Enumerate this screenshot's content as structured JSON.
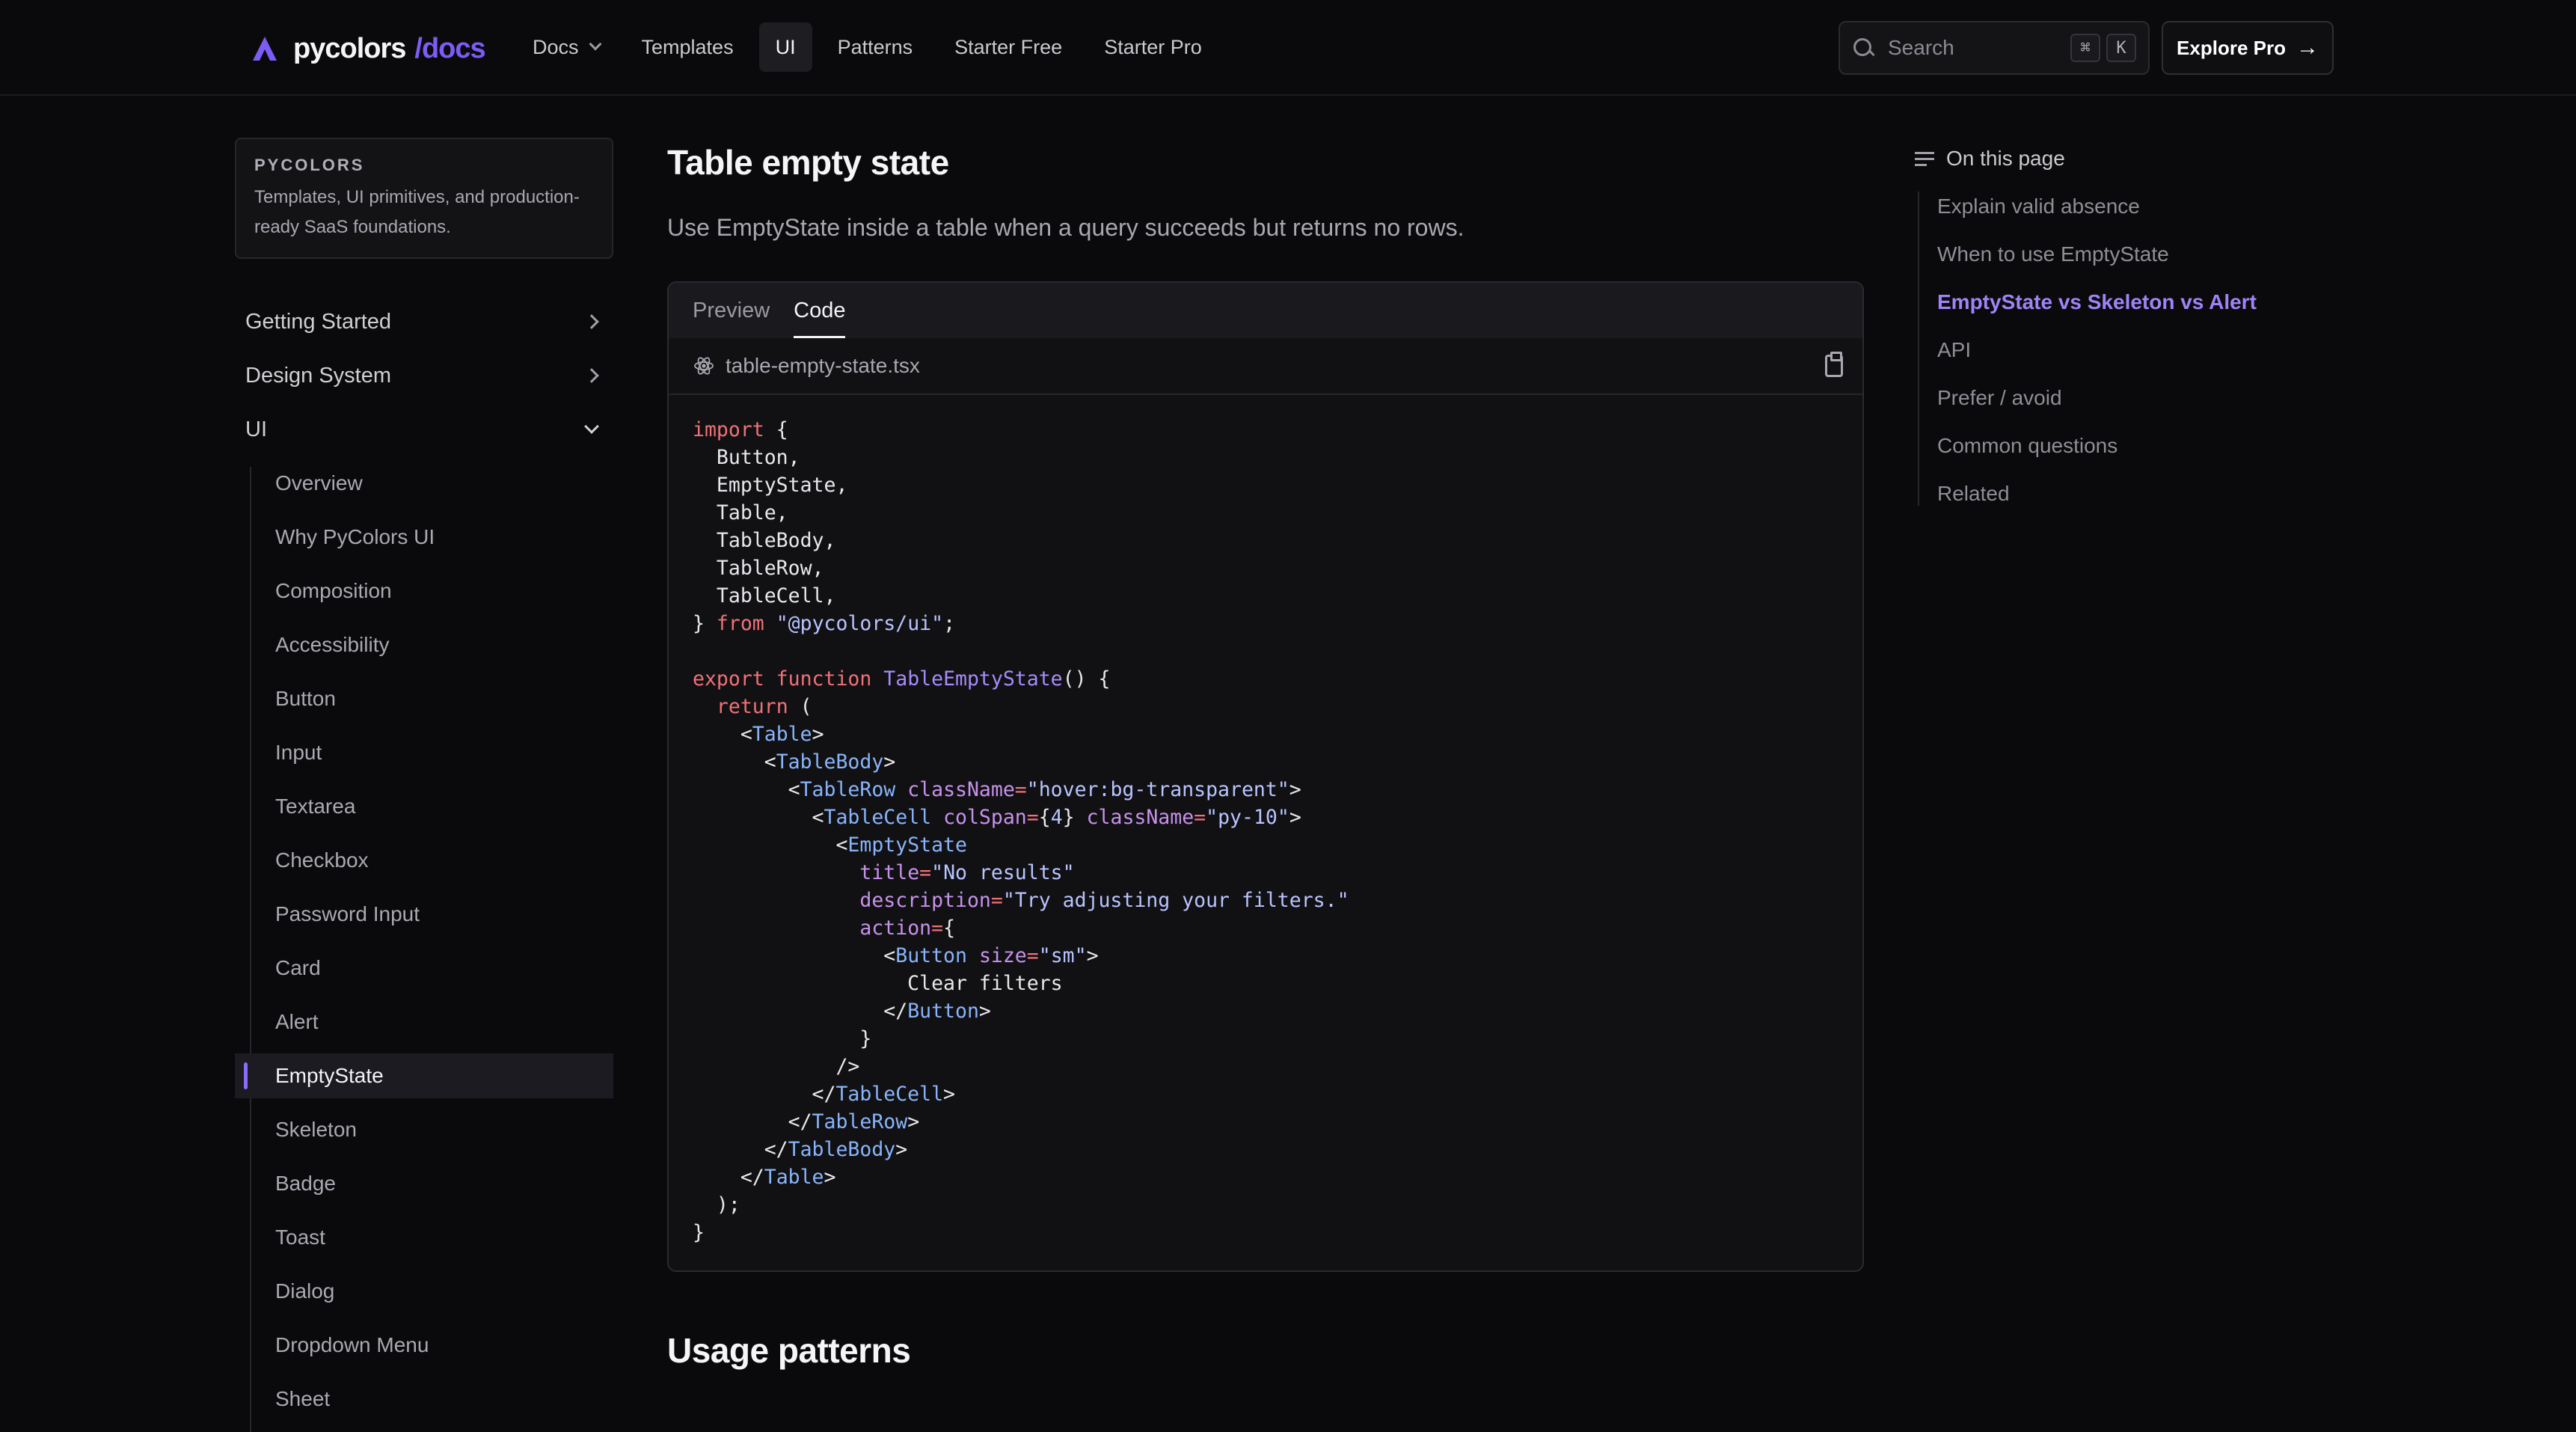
{
  "header": {
    "logo_text": "pycolors",
    "logo_suffix": "/docs",
    "nav": [
      {
        "label": "Docs",
        "has_dropdown": true,
        "active": false
      },
      {
        "label": "Templates",
        "active": false
      },
      {
        "label": "UI",
        "active": true
      },
      {
        "label": "Patterns",
        "active": false
      },
      {
        "label": "Starter Free",
        "active": false
      },
      {
        "label": "Starter Pro",
        "active": false
      }
    ],
    "search_placeholder": "Search",
    "shortcut_keys": [
      "⌘",
      "K"
    ],
    "explore_label": "Explore Pro"
  },
  "sidebar": {
    "brand_title": "PYCOLORS",
    "brand_desc": "Templates, UI primitives, and production-ready SaaS foundations.",
    "sections": [
      {
        "label": "Getting Started",
        "expanded": false
      },
      {
        "label": "Design System",
        "expanded": false
      },
      {
        "label": "UI",
        "expanded": true
      }
    ],
    "ui_items": [
      {
        "label": "Overview"
      },
      {
        "label": "Why PyColors UI"
      },
      {
        "label": "Composition"
      },
      {
        "label": "Accessibility"
      },
      {
        "label": "Button"
      },
      {
        "label": "Input"
      },
      {
        "label": "Textarea"
      },
      {
        "label": "Checkbox"
      },
      {
        "label": "Password Input"
      },
      {
        "label": "Card"
      },
      {
        "label": "Alert"
      },
      {
        "label": "EmptyState",
        "active": true
      },
      {
        "label": "Skeleton"
      },
      {
        "label": "Badge"
      },
      {
        "label": "Toast"
      },
      {
        "label": "Dialog"
      },
      {
        "label": "Dropdown Menu"
      },
      {
        "label": "Sheet"
      }
    ]
  },
  "main": {
    "title": "Table empty state",
    "lead": "Use EmptyState inside a table when a query succeeds but returns no rows.",
    "tabs": [
      {
        "label": "Preview",
        "active": false
      },
      {
        "label": "Code",
        "active": true
      }
    ],
    "file_name": "table-empty-state.tsx",
    "code": "import {\n  Button,\n  EmptyState,\n  Table,\n  TableBody,\n  TableRow,\n  TableCell,\n} from \"@pycolors/ui\";\n\nexport function TableEmptyState() {\n  return (\n    <Table>\n      <TableBody>\n        <TableRow className=\"hover:bg-transparent\">\n          <TableCell colSpan={4} className=\"py-10\">\n            <EmptyState\n              title=\"No results\"\n              description=\"Try adjusting your filters.\"\n              action={\n                <Button size=\"sm\">\n                  Clear filters\n                </Button>\n              }\n            />\n          </TableCell>\n        </TableRow>\n      </TableBody>\n    </Table>\n  );\n}",
    "next_heading": "Usage patterns"
  },
  "toc": {
    "heading": "On this page",
    "items": [
      {
        "label": "Explain valid absence"
      },
      {
        "label": "When to use EmptyState"
      },
      {
        "label": "EmptyState vs Skeleton vs Alert",
        "active": true
      },
      {
        "label": "API"
      },
      {
        "label": "Prefer / avoid"
      },
      {
        "label": "Common questions"
      },
      {
        "label": "Related"
      }
    ]
  },
  "colors": {
    "accent": "#8b6cf6",
    "background": "#0a0a0c",
    "code_keyword": "#f07178",
    "code_string": "#b9c4ff",
    "code_tag": "#89b4fa",
    "code_function": "#a78bfa"
  }
}
